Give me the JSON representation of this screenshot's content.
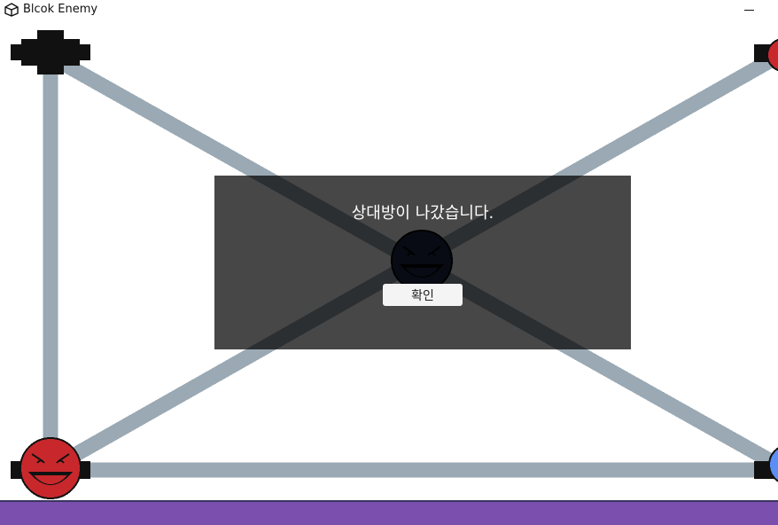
{
  "window": {
    "title": "Blcok Enemy",
    "minimize_label": ""
  },
  "game": {
    "colors": {
      "path": "#9aa9b3",
      "node": "#111111",
      "red_player": "#c8282c",
      "enemy": "#1d2a4a",
      "blue_player": "#5b8ff5",
      "bottom_bar": "#7a4fae"
    }
  },
  "dialog": {
    "message": "상대방이 나갔습니다.",
    "confirm_label": "확인"
  }
}
